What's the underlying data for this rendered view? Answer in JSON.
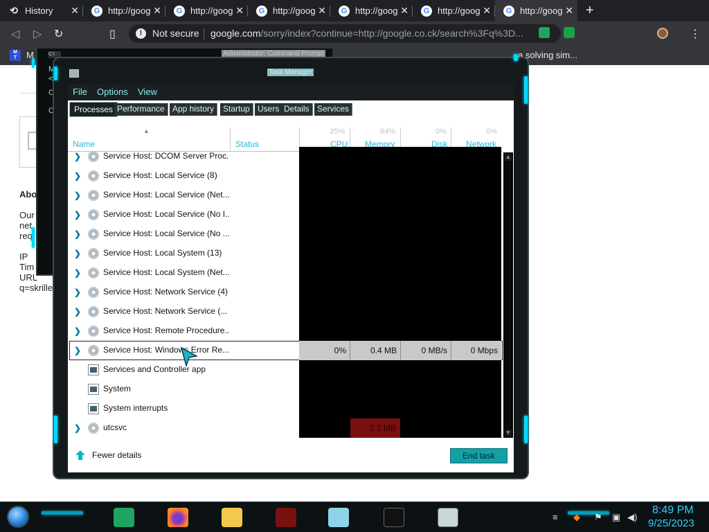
{
  "browser": {
    "tabs": [
      {
        "title": "History",
        "icon": "history-icon",
        "active": false
      },
      {
        "title": "http://goog",
        "icon": "google-favicon-icon",
        "active": false
      },
      {
        "title": "http://goog",
        "icon": "google-favicon-icon",
        "active": false
      },
      {
        "title": "http://goog",
        "icon": "google-favicon-icon",
        "active": false
      },
      {
        "title": "http://goog",
        "icon": "google-favicon-icon",
        "active": false
      },
      {
        "title": "http://goog",
        "icon": "google-favicon-icon",
        "active": false
      },
      {
        "title": "http://goog",
        "icon": "google-favicon-icon",
        "active": true
      }
    ],
    "security_label": "Not secure",
    "url_host": "google.com",
    "url_rest": "/sorry/index?continue=http://google.co.ck/search%3Fq%3D...",
    "bookmark_right": "a solving sim...",
    "bookmark_left_label": "M"
  },
  "page": {
    "heading_fragment": "Abo",
    "lines": [
      "Our",
      "net",
      "req",
      "IP",
      "Tim",
      "URL",
      "q=skrillex"
    ]
  },
  "cmd": {
    "title": "Administrator: Command Prompt",
    "lines": [
      "M",
      "<",
      "C",
      "C"
    ]
  },
  "taskmanager": {
    "title": "Task Manager",
    "menu": [
      "File",
      "Options",
      "View"
    ],
    "tabs": [
      "Processes",
      "Performance",
      "App history",
      "Startup",
      "Users",
      "Details",
      "Services"
    ],
    "active_tab": "Processes",
    "columns": {
      "name": "Name",
      "status": "Status",
      "cpu_pct": "35%",
      "cpu": "CPU",
      "memory_pct": "64%",
      "memory": "Memory",
      "disk_pct": "0%",
      "disk": "Disk",
      "network_pct": "0%",
      "network": "Network"
    },
    "rows": [
      {
        "name": "Service Host: DCOM Server Proc...",
        "expandable": true,
        "icon": "gear"
      },
      {
        "name": "Service Host: Local Service (8)",
        "expandable": true,
        "icon": "gear"
      },
      {
        "name": "Service Host: Local Service (Net...",
        "expandable": true,
        "icon": "gear"
      },
      {
        "name": "Service Host: Local Service (No I...",
        "expandable": true,
        "icon": "gear"
      },
      {
        "name": "Service Host: Local Service (No ...",
        "expandable": true,
        "icon": "gear"
      },
      {
        "name": "Service Host: Local System (13)",
        "expandable": true,
        "icon": "gear"
      },
      {
        "name": "Service Host: Local System (Net...",
        "expandable": true,
        "icon": "gear"
      },
      {
        "name": "Service Host: Network Service (4)",
        "expandable": true,
        "icon": "gear"
      },
      {
        "name": "Service Host: Network Service (...",
        "expandable": true,
        "icon": "gear"
      },
      {
        "name": "Service Host: Remote Procedure...",
        "expandable": true,
        "icon": "gear"
      },
      {
        "name": "Service Host: Windows Error Re...",
        "expandable": true,
        "icon": "gear",
        "selected": true,
        "cpu": "0%",
        "memory": "0.4 MB",
        "disk": "0 MB/s",
        "network": "0 Mbps"
      },
      {
        "name": "Services and Controller app",
        "expandable": false,
        "icon": "app"
      },
      {
        "name": "System",
        "expandable": false,
        "icon": "app"
      },
      {
        "name": "System interrupts",
        "expandable": false,
        "icon": "app"
      },
      {
        "name": "utcsvc",
        "expandable": true,
        "icon": "gear",
        "memory": "2.1 MB",
        "memory_high": true
      }
    ],
    "fewer_details": "Fewer details",
    "end_task": "End task"
  },
  "taskbar": {
    "time": "8:49 PM",
    "date": "9/25/2023"
  },
  "colors": {
    "accent_neon": "#00d8ff",
    "header_label": "#29b7d6",
    "end_task_bg": "#13a0a9",
    "memory_high": "#7a0f0f",
    "clock": "#35d0ff"
  }
}
